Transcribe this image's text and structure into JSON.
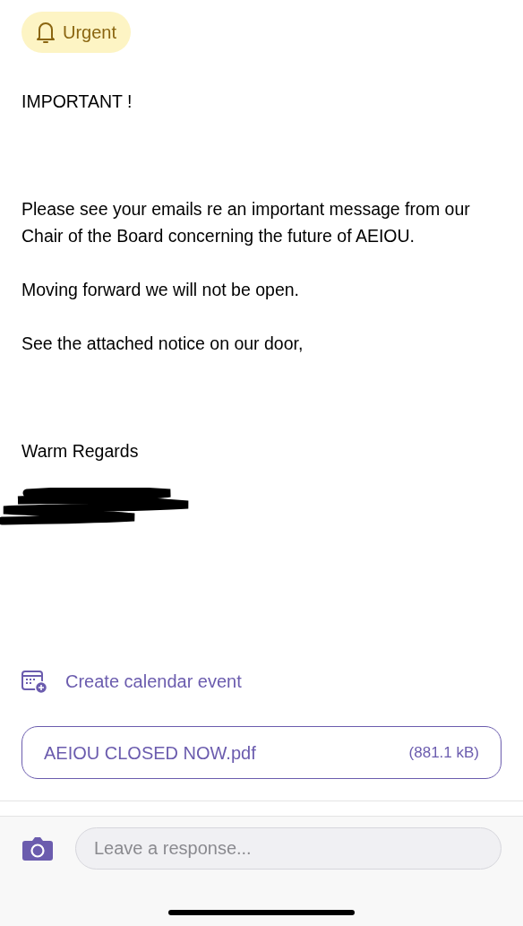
{
  "badge": {
    "label": "Urgent"
  },
  "message": {
    "paragraphs": [
      "IMPORTANT !",
      "Please see your emails re an important message from our Chair of the Board concerning the future of AEIOU.",
      "Moving forward we will not be open.",
      "See the attached notice on our door,",
      "Warm Regards"
    ]
  },
  "calendar_link": {
    "label": "Create calendar event"
  },
  "attachment": {
    "name": "AEIOU CLOSED NOW.pdf",
    "size": "(881.1 kB)"
  },
  "response": {
    "placeholder": "Leave a response..."
  }
}
